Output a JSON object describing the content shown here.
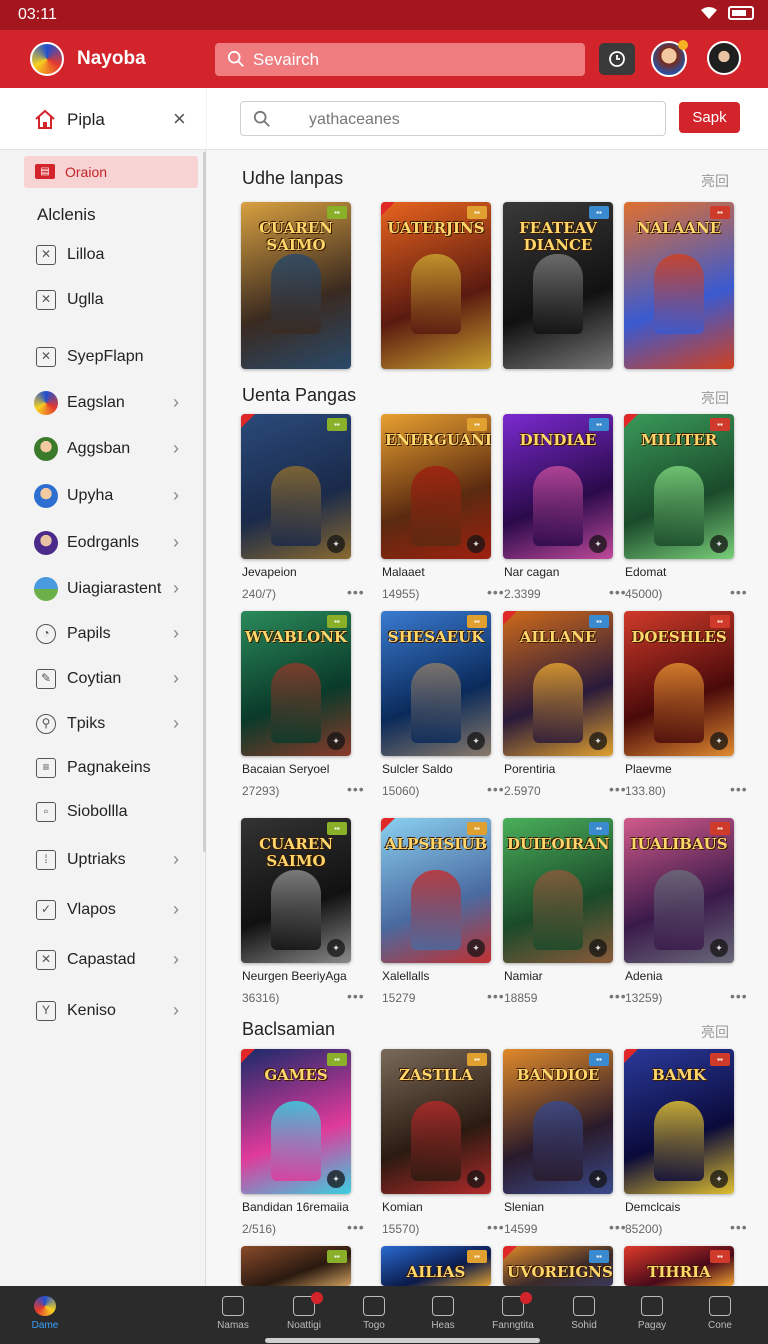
{
  "status": {
    "time": "03:11"
  },
  "app": {
    "name": "Nayoba",
    "search_placeholder": "Sevairch"
  },
  "sidebar": {
    "header_label": "Pipla",
    "active_item": {
      "icon_text": "▤",
      "label": "Oraion"
    },
    "section_label": "Alclenis",
    "items": [
      {
        "label": "Lilloa",
        "icon": "box-x-icon",
        "chevron": false
      },
      {
        "label": "Uglla",
        "icon": "box-x-icon",
        "chevron": false
      },
      {
        "label": "SyepFlapn",
        "icon": "box-x-icon",
        "chevron": false
      },
      {
        "label": "Eagslan",
        "icon": "avatar-icon",
        "chevron": true
      },
      {
        "label": "Aggsban",
        "icon": "avatar-icon",
        "chevron": true
      },
      {
        "label": "Upyha",
        "icon": "avatar-icon",
        "chevron": true
      },
      {
        "label": "Eodrganls",
        "icon": "avatar-icon",
        "chevron": true
      },
      {
        "label": "Uiagiarastent",
        "icon": "avatar-icon",
        "chevron": true
      },
      {
        "label": "Papils",
        "icon": "clock-icon",
        "chevron": true
      },
      {
        "label": "Coytian",
        "icon": "feather-icon",
        "chevron": true
      },
      {
        "label": "Tpiks",
        "icon": "search-icon",
        "chevron": true
      },
      {
        "label": "Pagnakeins",
        "icon": "stack-icon",
        "chevron": false
      },
      {
        "label": "Siobollla",
        "icon": "square-icon",
        "chevron": false
      },
      {
        "label": "Uptriaks",
        "icon": "grid-icon",
        "chevron": true
      },
      {
        "label": "Vlapos",
        "icon": "check-box-icon",
        "chevron": true
      },
      {
        "label": "Capastad",
        "icon": "box-x-icon",
        "chevron": true
      },
      {
        "label": "Keniso",
        "icon": "box-y-icon",
        "chevron": true
      }
    ]
  },
  "main": {
    "search_placeholder": "yathaceanes",
    "search_button": "Sapk",
    "sections": [
      {
        "title": "Udhe lanpas",
        "more": "亮回"
      },
      {
        "title": "Uenta Pangas",
        "more": "亮回"
      },
      {
        "title": "Baclsamian",
        "more": "亮回"
      }
    ],
    "featured": [
      {
        "art_title": "CUAREN SAIMO"
      },
      {
        "art_title": "UATERJINS"
      },
      {
        "art_title": "FEATEAV DIANCE"
      },
      {
        "art_title": "NALAANE"
      }
    ],
    "grid": [
      {
        "art_title": "",
        "name": "Jevapeion",
        "count": "240/7)"
      },
      {
        "art_title": "ENERGUAND",
        "name": "Malaaet",
        "count": "14955)"
      },
      {
        "art_title": "DINDIAE",
        "name": "Nar cagan",
        "count": "2.3399"
      },
      {
        "art_title": "MILITER",
        "name": "Edomat",
        "count": "45000)"
      },
      {
        "art_title": "WVABLONK",
        "name": "Bacaian Seryoel",
        "count": "27293)"
      },
      {
        "art_title": "SHESAEUK",
        "name": "Sulcler Saldo",
        "count": "15060)"
      },
      {
        "art_title": "AILLANE",
        "name": "Porentiria",
        "count": "2.5970"
      },
      {
        "art_title": "DOESHLES",
        "name": "Plaevme",
        "count": "133.80)"
      },
      {
        "art_title": "CUAREN SAIMO",
        "name": "Neurgen BeeriyAga",
        "count": "36316)"
      },
      {
        "art_title": "ALPSHSIUB",
        "name": "Xalellalls",
        "count": "15279"
      },
      {
        "art_title": "DUIEOIRAN",
        "name": "Namiar",
        "count": "18859"
      },
      {
        "art_title": "IUALIBAUS",
        "name": "Adenia",
        "count": "13259)"
      }
    ],
    "recent": [
      {
        "art_title": "GAMES",
        "name": "Bandidan 16remaiia",
        "count": "2/516)"
      },
      {
        "art_title": "ZASTILA",
        "name": "Komian",
        "count": "15570)"
      },
      {
        "art_title": "BANDIOE",
        "name": "Slenian",
        "count": "14599"
      },
      {
        "art_title": "BAMK",
        "name": "Demclcais",
        "count": "85200)"
      }
    ],
    "peek": [
      {
        "art_title": ""
      },
      {
        "art_title": "AILIAS"
      },
      {
        "art_title": "UVOREIGNS"
      },
      {
        "art_title": "TIHRIA"
      }
    ]
  },
  "bottom_nav": [
    {
      "label": "Dame",
      "active": true,
      "badge": false
    },
    {
      "label": "Namas",
      "active": false,
      "badge": false
    },
    {
      "label": "Noattigi",
      "active": false,
      "badge": true
    },
    {
      "label": "Togo",
      "active": false,
      "badge": false
    },
    {
      "label": "Heas",
      "active": false,
      "badge": false
    },
    {
      "label": "Fanngtita",
      "active": false,
      "badge": true
    },
    {
      "label": "Sohid",
      "active": false,
      "badge": false
    },
    {
      "label": "Pagay",
      "active": false,
      "badge": false
    },
    {
      "label": "Cone",
      "active": false,
      "badge": false
    }
  ]
}
